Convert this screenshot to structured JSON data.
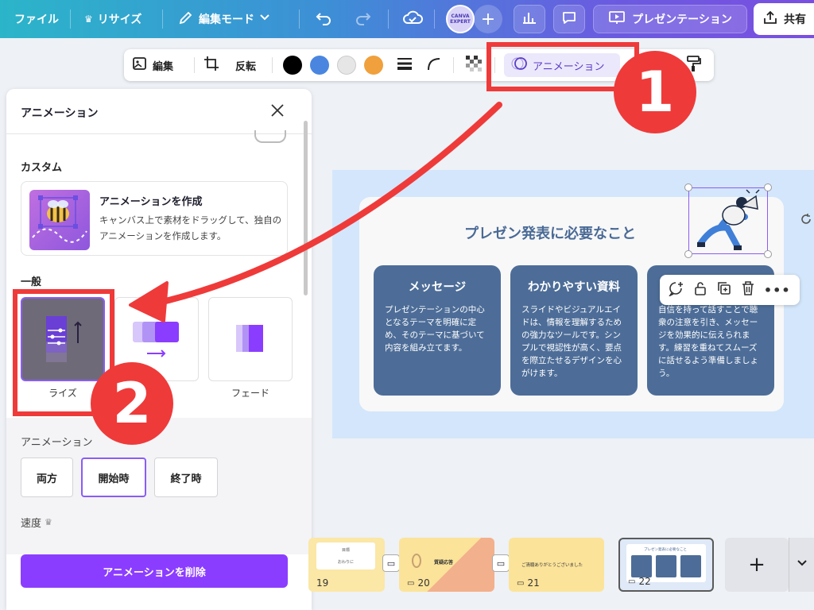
{
  "topbar": {
    "file": "ファイル",
    "resize": "リサイズ",
    "edit_mode": "編集モード",
    "avatar_text": "CANVA EXPERT",
    "present": "プレゼンテーション",
    "share": "共有"
  },
  "floating_toolbar": {
    "edit": "編集",
    "flip": "反転",
    "animation": "アニメーション",
    "colors": [
      "#000000",
      "#4a86e0",
      "#e6e6e6",
      "#f0a03c"
    ]
  },
  "panel": {
    "title": "アニメーション",
    "custom_heading": "カスタム",
    "custom_title": "アニメーションを作成",
    "custom_desc": "キャンバス上で素材をドラッグして、独自のアニメーションを作成します。",
    "general_heading": "一般",
    "tiles": [
      {
        "label": "ライズ"
      },
      {
        "label": ""
      },
      {
        "label": "フェード"
      }
    ],
    "animation_heading": "アニメーション",
    "modes": [
      "両方",
      "開始時",
      "終了時"
    ],
    "active_mode": "開始時",
    "speed_label": "速度",
    "delete_button": "アニメーションを削除"
  },
  "slide": {
    "title": "プレゼン発表に必要なこと",
    "cards": [
      {
        "heading": "メッセージ",
        "text": "プレゼンテーションの中心となるテーマを明確に定め、そのテーマに基づいて内容を組み立てます。"
      },
      {
        "heading": "わかりやすい資料",
        "text": "スライドやビジュアルエイドは、情報を理解するための強力なツールです。シンプルで視認性が高く、要点を際立たせるデザインを心がけます。"
      },
      {
        "heading": "",
        "text": "自信を持って話すことで聴衆の注意を引き、メッセージを効果的に伝えられます。練習を重ねてスムーズに話せるよう準備しましょう。"
      }
    ]
  },
  "filmstrip": {
    "slides": [
      {
        "num": "19",
        "caption": "目標",
        "subcaption": "おわりに"
      },
      {
        "num": "20",
        "caption": "質疑応答",
        "subcaption": ""
      },
      {
        "num": "21",
        "caption": "ご清聴ありがとうございました",
        "subcaption": ""
      },
      {
        "num": "22",
        "caption": "プレゼン発表に必要なこと",
        "subcaption": ""
      }
    ],
    "add": "+"
  },
  "annotations": {
    "step1": "1",
    "step2": "2",
    "accent": "#ef3a3a"
  }
}
